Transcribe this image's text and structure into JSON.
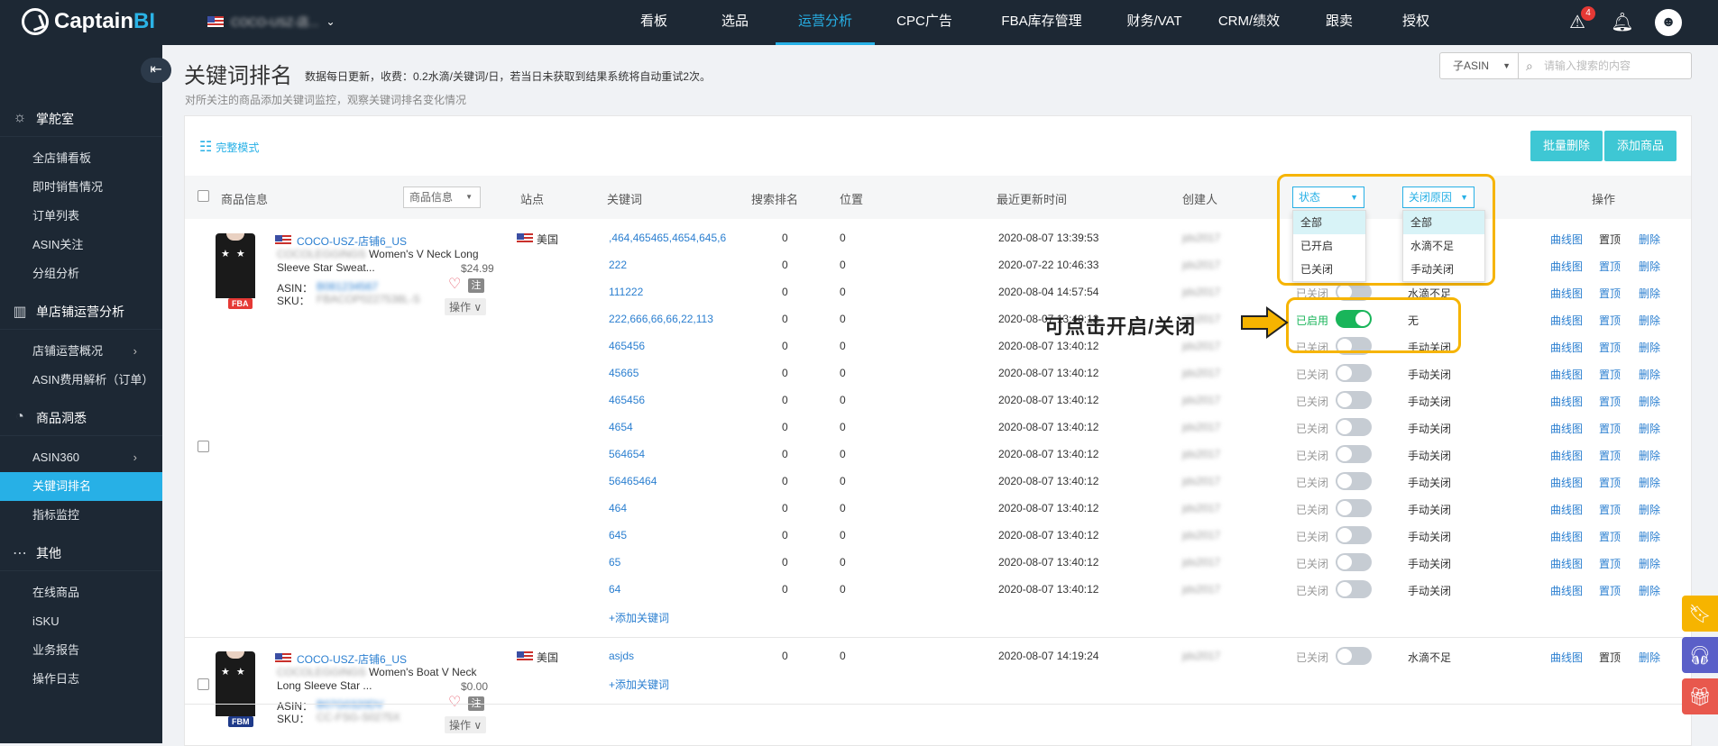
{
  "app": {
    "logo_text": "Captain",
    "logo_bi": "BI",
    "shop_name": "COCO-USZ-店...",
    "notification_count": "4"
  },
  "nav": [
    "看板",
    "选品",
    "运营分析",
    "CPC广告",
    "FBA库存管理",
    "财务/VAT",
    "CRM/绩效",
    "跟卖",
    "授权"
  ],
  "nav_active": "运营分析",
  "sidebar": {
    "groups": [
      {
        "label": "掌舵室",
        "items": [
          "全店铺看板",
          "即时销售情况",
          "订单列表",
          "ASIN关注",
          "分组分析"
        ]
      },
      {
        "label": "单店铺运营分析",
        "items": [
          "店铺运营概况",
          "ASIN费用解析（订单）"
        ]
      },
      {
        "label": "商品洞悉",
        "items": [
          "ASIN360",
          "关键词排名",
          "指标监控"
        ]
      },
      {
        "label": "其他",
        "items": [
          "在线商品",
          "iSKU",
          "业务报告",
          "操作日志"
        ]
      }
    ],
    "active_item": "关键词排名"
  },
  "page": {
    "title": "关键词排名",
    "note": "数据每日更新，收费：0.2水滴/关键词/日，若当日未获取到结果系统将自动重试2次。",
    "subtitle": "对所关注的商品添加关键词监控，观察关键词排名变化情况",
    "asin_type": "子ASIN",
    "search_placeholder": "请输入搜索的内容",
    "full_mode": "完整模式",
    "batch_delete": "批量删除",
    "add_product": "添加商品"
  },
  "table": {
    "headers": {
      "product": "商品信息",
      "product_filter": "商品信息",
      "site": "站点",
      "keyword": "关键词",
      "search_rank": "搜索排名",
      "position": "位置",
      "updated": "最近更新时间",
      "creator": "创建人",
      "status": "状态",
      "close_reason": "关闭原因",
      "action": "操作"
    },
    "status_options": [
      "全部",
      "已开启",
      "已关闭"
    ],
    "reason_options": [
      "全部",
      "水滴不足",
      "手动关闭"
    ],
    "actions": {
      "chart": "曲线图",
      "top": "置顶",
      "delete": "删除"
    },
    "add_keyword": "+添加关键词",
    "products": [
      {
        "store": "COCO-USZ-店铺6_US",
        "title_prefix": "COCOLEGGINGS",
        "title": "Women's V Neck Long Sleeve Star Sweat...",
        "price": "$24.99",
        "asin_label": "ASIN：",
        "asin": "B081234567",
        "sku_label": "SKU：",
        "sku": "FBACOP0227538L-S",
        "tag": "FBA",
        "site": "美国",
        "op_label": "操作",
        "note_label": "注",
        "rows": [
          {
            "keyword": ",464,465465,4654,645,6",
            "rank": "0",
            "pos": "0",
            "time": "2020-08-07 13:39:53",
            "creator": "jds2017",
            "status": "",
            "on": false,
            "reason": ""
          },
          {
            "keyword": "222",
            "rank": "0",
            "pos": "0",
            "time": "2020-07-22 10:46:33",
            "creator": "jds2017",
            "status": "",
            "on": false,
            "reason": ""
          },
          {
            "keyword": "111222",
            "rank": "0",
            "pos": "0",
            "time": "2020-08-04 14:57:54",
            "creator": "jds2017",
            "status": "已关闭",
            "on": false,
            "reason": "水滴不足"
          },
          {
            "keyword": "222,666,66,66,22,113",
            "rank": "0",
            "pos": "0",
            "time": "2020-08-07 13:40:12",
            "creator": "jds2017",
            "status": "已启用",
            "on": true,
            "reason": "无"
          },
          {
            "keyword": "465456",
            "rank": "0",
            "pos": "0",
            "time": "2020-08-07 13:40:12",
            "creator": "jds2017",
            "status": "已关闭",
            "on": false,
            "reason": "手动关闭"
          },
          {
            "keyword": "45665",
            "rank": "0",
            "pos": "0",
            "time": "2020-08-07 13:40:12",
            "creator": "jds2017",
            "status": "已关闭",
            "on": false,
            "reason": "手动关闭"
          },
          {
            "keyword": "465456",
            "rank": "0",
            "pos": "0",
            "time": "2020-08-07 13:40:12",
            "creator": "jds2017",
            "status": "已关闭",
            "on": false,
            "reason": "手动关闭"
          },
          {
            "keyword": "4654",
            "rank": "0",
            "pos": "0",
            "time": "2020-08-07 13:40:12",
            "creator": "jds2017",
            "status": "已关闭",
            "on": false,
            "reason": "手动关闭"
          },
          {
            "keyword": "564654",
            "rank": "0",
            "pos": "0",
            "time": "2020-08-07 13:40:12",
            "creator": "jds2017",
            "status": "已关闭",
            "on": false,
            "reason": "手动关闭"
          },
          {
            "keyword": "56465464",
            "rank": "0",
            "pos": "0",
            "time": "2020-08-07 13:40:12",
            "creator": "jds2017",
            "status": "已关闭",
            "on": false,
            "reason": "手动关闭"
          },
          {
            "keyword": "464",
            "rank": "0",
            "pos": "0",
            "time": "2020-08-07 13:40:12",
            "creator": "jds2017",
            "status": "已关闭",
            "on": false,
            "reason": "手动关闭"
          },
          {
            "keyword": "645",
            "rank": "0",
            "pos": "0",
            "time": "2020-08-07 13:40:12",
            "creator": "jds2017",
            "status": "已关闭",
            "on": false,
            "reason": "手动关闭"
          },
          {
            "keyword": "65",
            "rank": "0",
            "pos": "0",
            "time": "2020-08-07 13:40:12",
            "creator": "jds2017",
            "status": "已关闭",
            "on": false,
            "reason": "手动关闭"
          },
          {
            "keyword": "64",
            "rank": "0",
            "pos": "0",
            "time": "2020-08-07 13:40:12",
            "creator": "jds2017",
            "status": "已关闭",
            "on": false,
            "reason": "手动关闭"
          }
        ]
      },
      {
        "store": "COCO-USZ-店铺6_US",
        "title_prefix": "COCOLEGGINGS",
        "title": "Women's Boat V Neck Long Sleeve Star ...",
        "price": "$0.00",
        "asin_label": "ASIN：",
        "asin": "B07G0320DV",
        "sku_label": "SKU：",
        "sku": "CC-FSG-S0275X",
        "tag": "FBM",
        "site": "美国",
        "op_label": "操作",
        "note_label": "注",
        "rows": [
          {
            "keyword": "asjds",
            "rank": "0",
            "pos": "0",
            "time": "2020-08-07 14:19:24",
            "creator": "jds2017",
            "status": "已关闭",
            "on": false,
            "reason": "水滴不足"
          }
        ]
      }
    ]
  },
  "annotation": {
    "callout": "可点击开启/关闭"
  },
  "colors": {
    "accent": "#27b0e6",
    "highlight": "#f6b400",
    "toggle_on": "#19b55a",
    "topbar": "#1d2834"
  }
}
